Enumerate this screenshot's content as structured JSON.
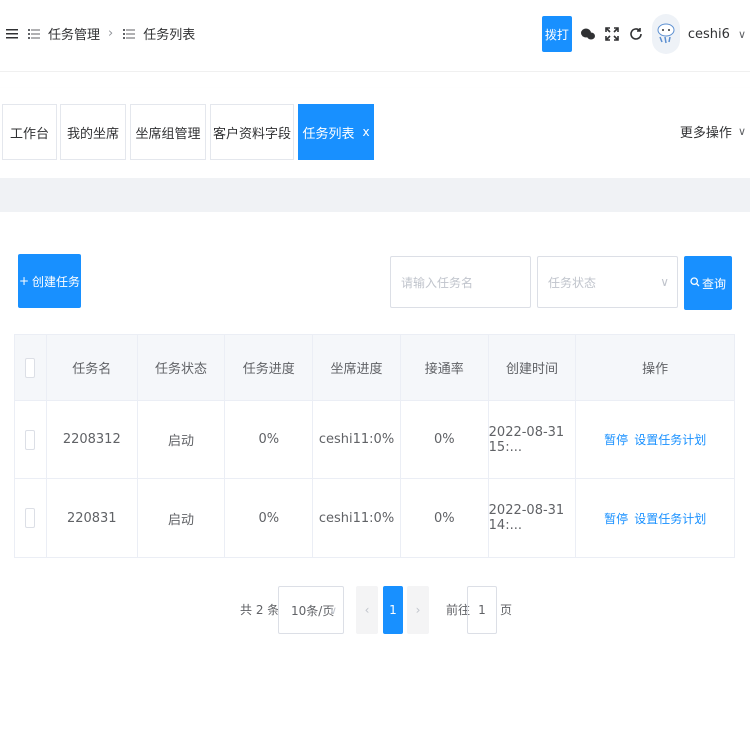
{
  "header": {
    "breadcrumb": [
      {
        "icon": "list-icon",
        "label": "任务管理"
      },
      {
        "icon": "list-icon",
        "label": "任务列表"
      }
    ],
    "dial_label": "拨打",
    "username": "ceshi6"
  },
  "tabs": [
    {
      "label": "工作台",
      "active": false
    },
    {
      "label": "我的坐席",
      "active": false
    },
    {
      "label": "坐席组管理",
      "active": false
    },
    {
      "label": "客户资料字段",
      "active": false
    },
    {
      "label": "任务列表",
      "active": true,
      "close": "x"
    }
  ],
  "more_actions": "更多操作",
  "toolbar": {
    "create_label": "创建任务",
    "task_name_placeholder": "请输入任务名",
    "task_status_placeholder": "任务状态",
    "query_label": "查询"
  },
  "table": {
    "columns": [
      "",
      "任务名",
      "任务状态",
      "任务进度",
      "坐席进度",
      "接通率",
      "创建时间",
      "操作"
    ],
    "rows": [
      {
        "name": "2208312",
        "status": "启动",
        "progress": "0%",
        "agent_progress": "ceshi11:0%",
        "rate": "0%",
        "created": "2022-08-31 15:...",
        "action1": "暂停",
        "action2": "设置任务计划"
      },
      {
        "name": "220831",
        "status": "启动",
        "progress": "0%",
        "agent_progress": "ceshi11:0%",
        "rate": "0%",
        "created": "2022-08-31 14:...",
        "action1": "暂停",
        "action2": "设置任务计划"
      }
    ]
  },
  "pagination": {
    "total": "共 2 条",
    "page_size": "10条/页",
    "current_page": "1",
    "goto_prefix": "前往",
    "goto_value": "1",
    "goto_suffix": "页"
  },
  "colors": {
    "accent": "#1890ff"
  }
}
